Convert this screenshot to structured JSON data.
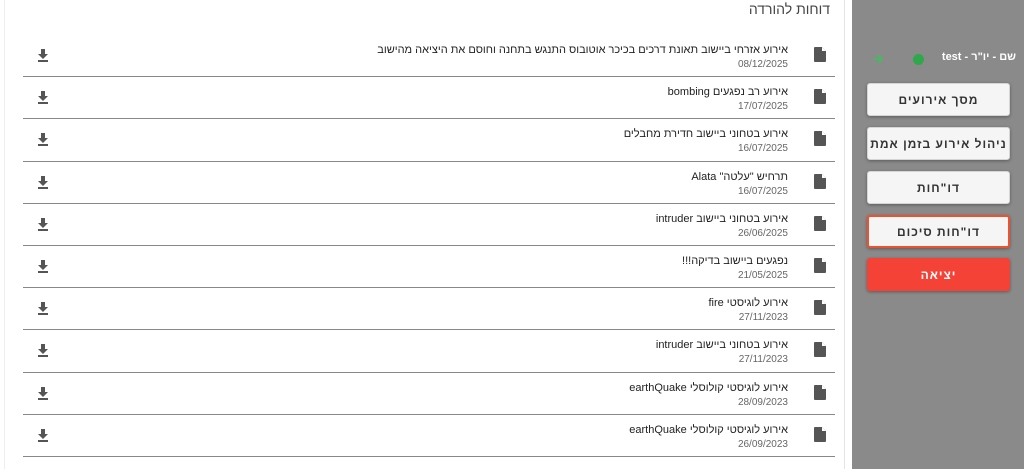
{
  "page": {
    "title": "דוחות להורדה"
  },
  "sidebar": {
    "user": "שם - יו\"ר - test",
    "buttons": [
      {
        "label": "מסך אירועים"
      },
      {
        "label": "ניהול אירוע בזמן אמת"
      },
      {
        "label": "דו\"חות"
      },
      {
        "label": "דו\"חות סיכום"
      },
      {
        "label": "יציאה"
      }
    ]
  },
  "colors": {
    "sidebar_bg": "#8a8a8a",
    "status_online": "#2ea84a",
    "logout": "#f44336",
    "selected_outline": "#f0502e"
  },
  "icons": {
    "file": "file-icon",
    "download": "download-icon",
    "status": "status-dot",
    "arrow": "arrow-right-icon"
  },
  "reports": [
    {
      "name": "אירוע אזרחי ביישוב תאונת דרכים בכיכר אוטובוס התנגש בתחנה וחוסם את היציאה מהישוב",
      "date": "08/12/2025"
    },
    {
      "name": "אירוע רב נפגעים bombing",
      "date": "17/07/2025"
    },
    {
      "name": "אירוע בטחוני ביישוב חדירת מחבלים",
      "date": "16/07/2025"
    },
    {
      "name": "תרחיש \"עלטה\" Alata",
      "date": "16/07/2025"
    },
    {
      "name": "אירוע בטחוני ביישוב intruder",
      "date": "26/06/2025"
    },
    {
      "name": "נפגעים ביישוב בדיקה!!!",
      "date": "21/05/2025"
    },
    {
      "name": "אירוע לוגיסטי fire",
      "date": "27/11/2023"
    },
    {
      "name": "אירוע בטחוני ביישוב intruder",
      "date": "27/11/2023"
    },
    {
      "name": "אירוע לוגיסטי קולוסלי earthQuake",
      "date": "28/09/2023"
    },
    {
      "name": "אירוע לוגיסטי קולוסלי earthQuake",
      "date": "26/09/2023"
    }
  ]
}
